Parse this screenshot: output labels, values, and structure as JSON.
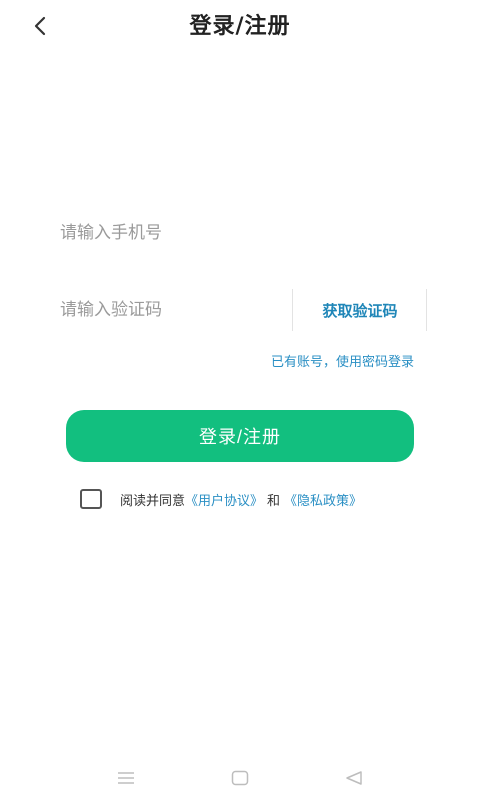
{
  "header": {
    "back_icon": "chevron-left-icon",
    "title": "登录/注册"
  },
  "form": {
    "phone_placeholder": "请输入手机号",
    "code_placeholder": "请输入验证码",
    "get_code_label": "获取验证码",
    "password_login_link": "已有账号，使用密码登录",
    "submit_label": "登录/注册"
  },
  "agreement": {
    "prefix": "阅读并同意",
    "user_agreement": "《用户协议》",
    "and": "和",
    "privacy_policy": "《隐私政策》",
    "checked": false
  },
  "navbar": {
    "icons": [
      "menu-icon",
      "home-icon",
      "back-triangle-icon"
    ]
  },
  "colors": {
    "accent": "#12bf7f",
    "link": "#2a8fc4",
    "title": "#222222"
  }
}
